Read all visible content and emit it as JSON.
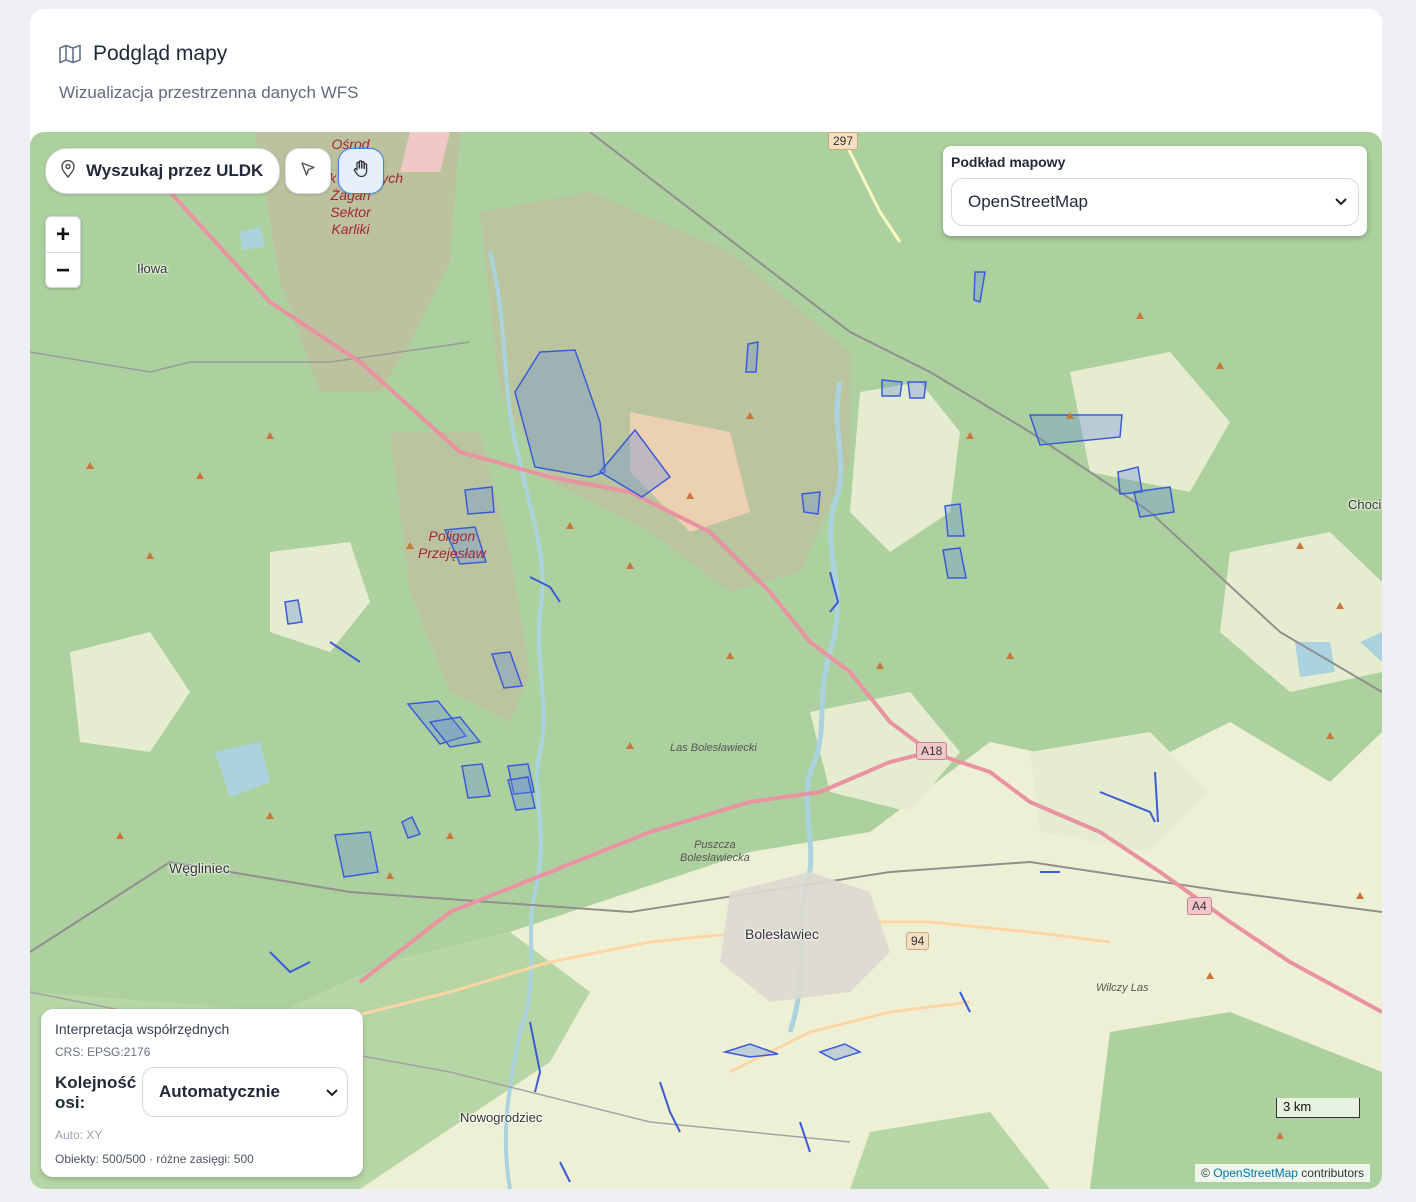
{
  "header": {
    "title": "Podgląd mapy",
    "subtitle": "Wizualizacja przestrzenna danych WFS",
    "icon": "map-icon"
  },
  "toolbar": {
    "search_label": "Wyszukaj przez ULDK",
    "search_icon": "map-pin-icon",
    "select_tool_icon": "cursor-arrow-icon",
    "pan_tool_icon": "hand-icon",
    "pan_tool_active": true
  },
  "zoom": {
    "in_label": "+",
    "out_label": "−"
  },
  "basemap": {
    "label": "Podkład mapowy",
    "selected": "OpenStreetMap"
  },
  "coords_panel": {
    "title": "Interpretacja współrzędnych",
    "crs": "CRS: EPSG:2176",
    "axis_order_label": "Kolejność osi:",
    "axis_order_value": "Automatycznie",
    "auto_info": "Auto: XY",
    "stats": "Obiekty: 500/500 · różne zasięgi: 500"
  },
  "scale_bar": "3 km",
  "attribution": {
    "prefix": "©",
    "link": "OpenStreetMap",
    "suffix": "contributors"
  },
  "map_labels": {
    "military_north": "Ośrodek Szkolenia Poligonowego Wojsk Lądowych Żagań Sektor Karliki",
    "military_north_visible": "Ośrod\ngo\nWojsk Lądowych\nŻagań\nSektor\nKarliki",
    "poligon": "Poligon\nPrzejęsław",
    "las_boleslawiecki": "Las Bolesławiecki",
    "puszcza": "Puszcza\nBolesławiecka",
    "wilczy_las": "Wilczy Las",
    "ilowa": "Iłowa",
    "weglinieciec": "Węgliniec",
    "boleslawiec": "Bolesławiec",
    "nowogrodziec": "Nowogrodziec",
    "chocianow": "Choci",
    "road_297": "297",
    "road_a18": "A18",
    "road_a4": "A4",
    "road_94": "94"
  },
  "colors": {
    "forest": "#add19e",
    "farmland": "#eef0d5",
    "military": "#c8b79e",
    "motorway": "#e892a2",
    "wfs_feature": "#3b5bd9"
  }
}
